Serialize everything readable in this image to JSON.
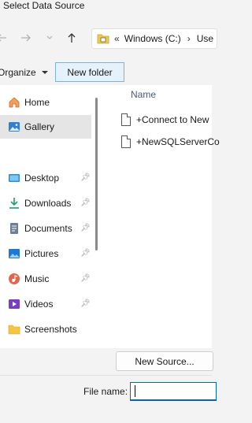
{
  "window": {
    "title": "Select Data Source"
  },
  "nav": {
    "path_prefix": "«",
    "path_segment": "Windows (C:)",
    "path_sep": "›",
    "path_next": "Use"
  },
  "toolbar": {
    "organize_label": "Organize",
    "new_folder_label": "New folder"
  },
  "sidebar": {
    "items": [
      {
        "label": "Home",
        "icon": "home-icon"
      },
      {
        "label": "Gallery",
        "icon": "gallery-icon",
        "selected": true
      },
      {
        "label": "Desktop",
        "icon": "desktop-icon",
        "pinned": true
      },
      {
        "label": "Downloads",
        "icon": "downloads-icon",
        "pinned": true
      },
      {
        "label": "Documents",
        "icon": "documents-icon",
        "pinned": true
      },
      {
        "label": "Pictures",
        "icon": "pictures-icon",
        "pinned": true
      },
      {
        "label": "Music",
        "icon": "music-icon",
        "pinned": true
      },
      {
        "label": "Videos",
        "icon": "videos-icon",
        "pinned": true
      },
      {
        "label": "Screenshots",
        "icon": "folder-icon"
      }
    ]
  },
  "filelist": {
    "column_name": "Name",
    "files": [
      {
        "name": "+Connect to New"
      },
      {
        "name": "+NewSQLServerCo"
      }
    ]
  },
  "footer": {
    "new_source_label": "New Source...",
    "file_name_label": "File name:",
    "file_name_value": ""
  },
  "colors": {
    "accent": "#0067c0",
    "selection": "#e5e5e5"
  }
}
